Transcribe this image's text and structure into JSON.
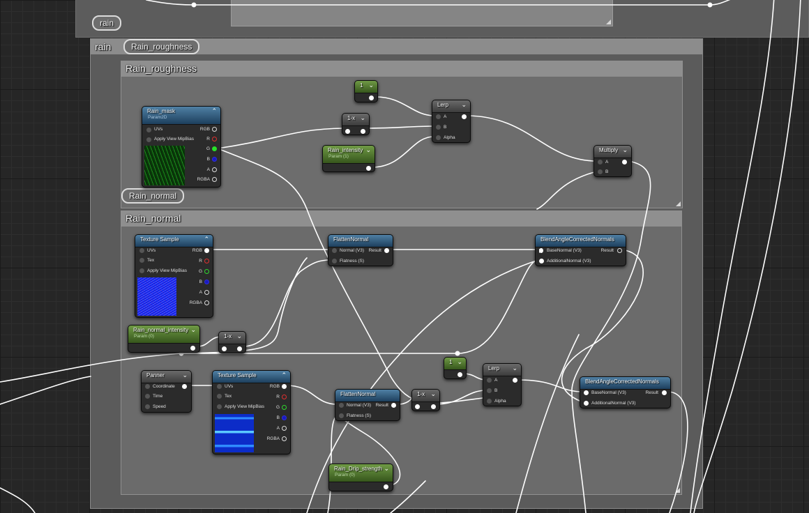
{
  "comments": {
    "rain_bubble": "rain",
    "rain_title": "rain",
    "rain_roughness_bubble": "Rain_roughness",
    "rain_roughness_title": "Rain_roughness",
    "rain_normal_bubble": "Rain_normal",
    "rain_normal_title": "Rain_normal"
  },
  "nodes": {
    "const_one_a": {
      "title": "1"
    },
    "one_minus_a": {
      "title": "1-x"
    },
    "lerp_a": {
      "title": "Lerp",
      "pins": [
        "A",
        "B",
        "Alpha"
      ]
    },
    "rain_intensity": {
      "title": "Rain_intensity",
      "subtitle": "Param (1)"
    },
    "multiply": {
      "title": "Multiply",
      "pins": [
        "A",
        "B"
      ]
    },
    "rain_mask": {
      "title": "Rain_mask",
      "subtitle": "Param2D",
      "inputs": [
        "UVs",
        "Apply View MipBias"
      ],
      "outputs": [
        "RGB",
        "R",
        "G",
        "B",
        "A",
        "RGBA"
      ]
    },
    "texture_sample_a": {
      "title": "Texture Sample",
      "inputs": [
        "UVs",
        "Tex",
        "Apply View MipBias"
      ],
      "outputs": [
        "RGB",
        "R",
        "G",
        "B",
        "A",
        "RGBA"
      ]
    },
    "flatten_normal_a": {
      "title": "FlattenNormal",
      "inputs": [
        "Normal (V3)",
        "Flatness (S)"
      ],
      "output": "Result"
    },
    "blend_a": {
      "title": "BlendAngleCorrectedNormals",
      "inputs": [
        "BaseNormal (V3)",
        "AdditionalNormal (V3)"
      ],
      "output": "Result"
    },
    "rain_normal_intensity": {
      "title": "Rain_normal_intensity",
      "subtitle": "Param (0)"
    },
    "one_minus_b": {
      "title": "1-x"
    },
    "panner": {
      "title": "Panner",
      "inputs": [
        "Coordinate",
        "Time",
        "Speed"
      ]
    },
    "texture_sample_b": {
      "title": "Texture Sample",
      "inputs": [
        "UVs",
        "Tex",
        "Apply View MipBias"
      ],
      "outputs": [
        "RGB",
        "R",
        "G",
        "B",
        "A",
        "RGBA"
      ]
    },
    "flatten_normal_b": {
      "title": "FlattenNormal",
      "inputs": [
        "Normal (V3)",
        "Flatness (S)"
      ],
      "output": "Result"
    },
    "one_minus_c": {
      "title": "1-x"
    },
    "const_one_b": {
      "title": "1"
    },
    "lerp_b": {
      "title": "Lerp",
      "pins": [
        "A",
        "B",
        "Alpha"
      ]
    },
    "blend_b": {
      "title": "BlendAngleCorrectedNormals",
      "inputs": [
        "BaseNormal (V3)",
        "AdditionalNormal (V3)"
      ],
      "output": "Result"
    },
    "rain_drip_strength": {
      "title": "Rain_Drip_strength",
      "subtitle": "Param (0)"
    }
  },
  "colors": {
    "background": "#262626",
    "comment_outer": "#5a5a5a",
    "comment_inner": "#6b6b6b",
    "wire": "#ffffff",
    "header_texture": "#2f5f85",
    "header_param": "#4e7a2a",
    "pin_green": "#29e029",
    "pin_red": "#e03030",
    "pin_blue": "#1a1ac0"
  }
}
